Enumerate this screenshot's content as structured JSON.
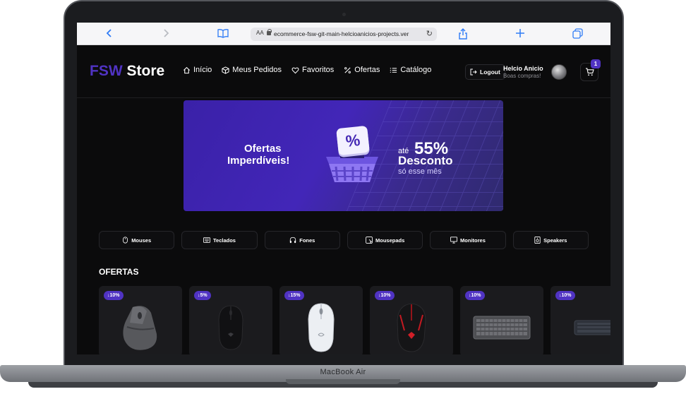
{
  "device": {
    "label": "MacBook Air"
  },
  "browser": {
    "aa_label": "AA",
    "url": "ecommerce-fsw-git-main-helcioanicios-projects.ver"
  },
  "header": {
    "logo_accent": "FSW",
    "logo_rest": " Store",
    "nav": [
      {
        "label": "Início",
        "icon": "home-icon"
      },
      {
        "label": "Meus Pedidos",
        "icon": "package-icon"
      },
      {
        "label": "Favoritos",
        "icon": "heart-icon"
      },
      {
        "label": "Ofertas",
        "icon": "percent-icon"
      },
      {
        "label": "Catálogo",
        "icon": "list-icon"
      }
    ],
    "logout_label": "Logout",
    "user_name": "Helcio Anicio",
    "user_greeting": "Boas compras!",
    "cart_count": "1"
  },
  "banner": {
    "line1": "Ofertas",
    "line2": "Imperdíveis!",
    "tag": "%",
    "ate": "até",
    "percent": "55%",
    "desconto": "Desconto",
    "so_mes": "só esse mês"
  },
  "categories": [
    {
      "label": "Mouses",
      "icon": "mouse-icon"
    },
    {
      "label": "Teclados",
      "icon": "keyboard-icon"
    },
    {
      "label": "Fones",
      "icon": "headphones-icon"
    },
    {
      "label": "Mousepads",
      "icon": "mousepad-icon"
    },
    {
      "label": "Monitores",
      "icon": "monitor-icon"
    },
    {
      "label": "Speakers",
      "icon": "speaker-icon"
    }
  ],
  "offers": {
    "title": "OFERTAS",
    "products": [
      {
        "discount": "10%",
        "kind": "mouse-mx"
      },
      {
        "discount": "5%",
        "kind": "mouse-black"
      },
      {
        "discount": "15%",
        "kind": "mouse-white"
      },
      {
        "discount": "10%",
        "kind": "mouse-red"
      },
      {
        "discount": "10%",
        "kind": "keyboard-gray"
      },
      {
        "discount": "10%",
        "kind": "keyboard-dark"
      }
    ]
  },
  "colors": {
    "accent": "#5033c3",
    "background": "#0b0b0c",
    "card": "#1b1b1e"
  }
}
